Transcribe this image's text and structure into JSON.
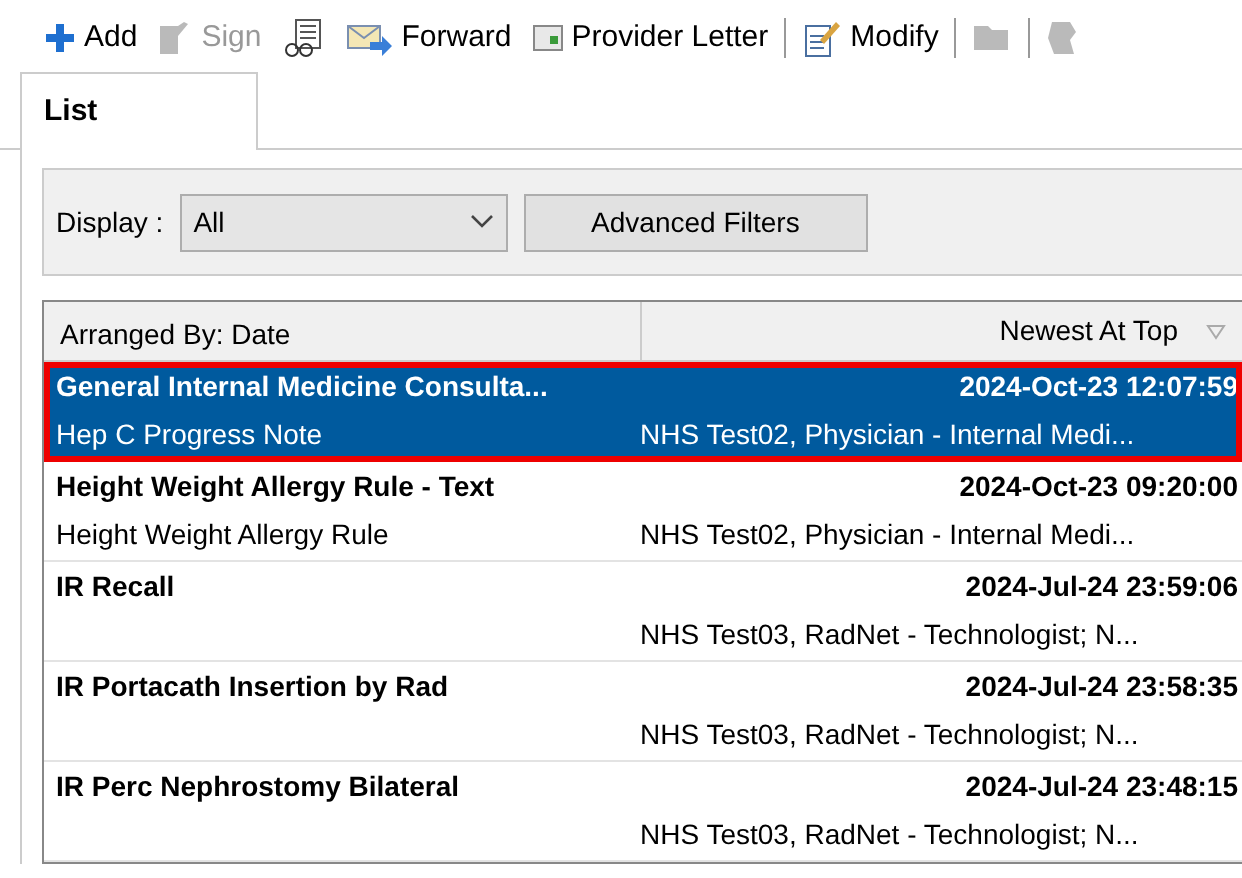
{
  "toolbar": [
    {
      "kind": "button",
      "label": "Add",
      "disabled": false
    },
    {
      "kind": "button",
      "label": "Sign",
      "disabled": true
    },
    {
      "kind": "button",
      "disabled": false
    },
    {
      "kind": "button",
      "label": "Forward",
      "disabled": false
    },
    {
      "kind": "button",
      "label": "Provider Letter",
      "disabled": false
    },
    {
      "kind": "separator"
    },
    {
      "kind": "button",
      "label": "Modify",
      "disabled": false
    },
    {
      "kind": "separator"
    },
    {
      "kind": "button",
      "disabled": true
    },
    {
      "kind": "separator"
    },
    {
      "kind": "button",
      "disabled": true
    }
  ],
  "tabs": [
    {
      "label": "List",
      "selected": true
    }
  ],
  "filter": {
    "label": "Display :",
    "value": "All",
    "button": "Advanced Filters"
  },
  "list": {
    "columns": [
      "Arranged By: Date",
      "Newest At Top"
    ],
    "items": [
      {
        "title": "General Internal Medicine Consulta...",
        "date": "2024-Oct-23 12:07:59",
        "subtitle": "Hep C Progress Note",
        "author": "NHS Test02, Physician - Internal Medi...",
        "selected": true,
        "highlighted": true
      },
      {
        "title": "Height Weight Allergy Rule - Text",
        "date": "2024-Oct-23 09:20:00",
        "subtitle": "Height Weight Allergy Rule",
        "author": "NHS Test02, Physician - Internal Medi...",
        "selected": false,
        "highlighted": false
      },
      {
        "title": "IR Recall",
        "date": "2024-Jul-24 23:59:06",
        "author": "NHS Test03, RadNet - Technologist; N...",
        "selected": false,
        "highlighted": false
      },
      {
        "title": "IR Portacath Insertion by Rad",
        "date": "2024-Jul-24 23:58:35",
        "author": "NHS Test03, RadNet - Technologist; N...",
        "selected": false,
        "highlighted": false
      },
      {
        "title": "IR Perc Nephrostomy Bilateral",
        "date": "2024-Jul-24 23:48:15",
        "author": "NHS Test03, RadNet - Technologist; N...",
        "selected": false,
        "highlighted": false
      }
    ]
  }
}
